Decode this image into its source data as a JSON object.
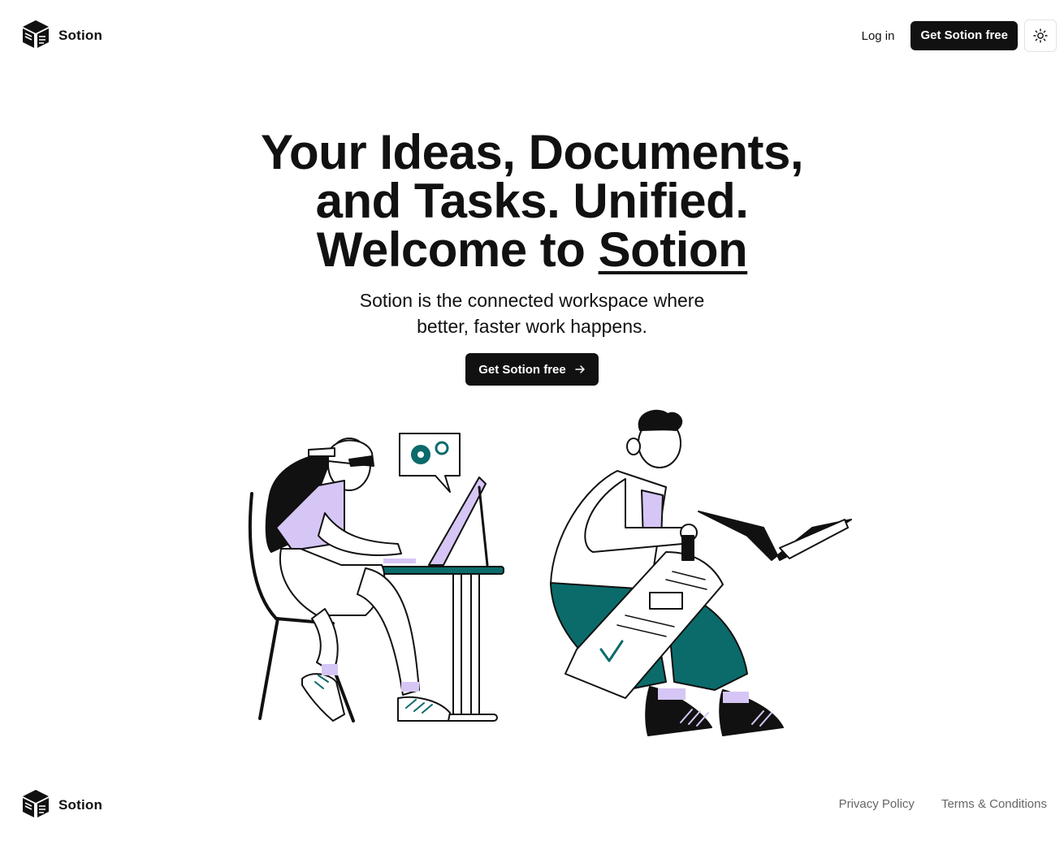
{
  "nav": {
    "brand": "Sotion",
    "login_label": "Log in",
    "cta_label": "Get Sotion free",
    "theme_icon": "sun-icon"
  },
  "hero": {
    "title_line1": "Your Ideas, Documents,",
    "title_line2": "and Tasks. Unified.",
    "title_line3_prefix": "Welcome to",
    "title_line3_brand": "Sotion",
    "subtitle_line1": "Sotion is the connected workspace where",
    "subtitle_line2": "better, faster work happens.",
    "cta_label": "Get Sotion free",
    "cta_icon": "arrow-right-icon"
  },
  "footer": {
    "brand": "Sotion",
    "privacy_label": "Privacy Policy",
    "terms_label": "Terms & Conditions"
  },
  "colors": {
    "accent_teal": "#0b6b6b",
    "accent_lavender": "#d6c6f5",
    "dark": "#111111"
  }
}
